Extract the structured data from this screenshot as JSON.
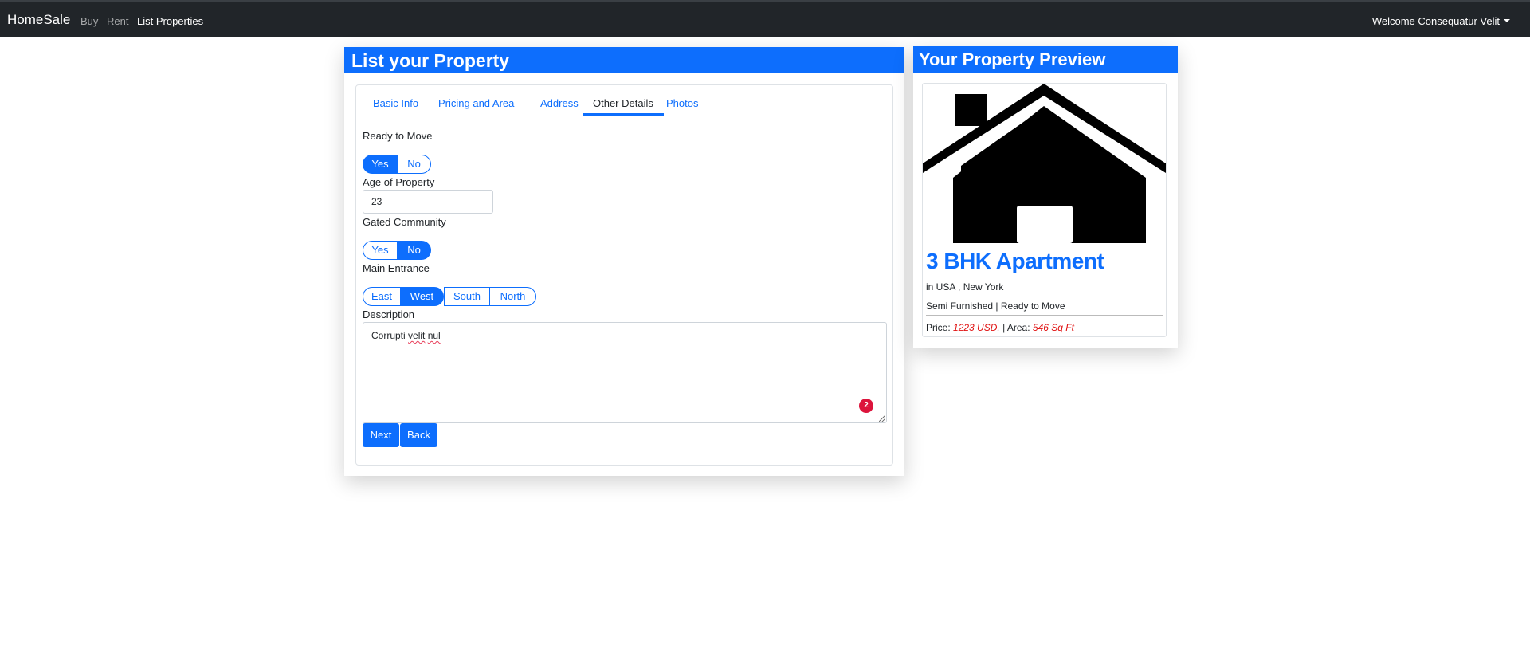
{
  "navbar": {
    "brand": "HomeSale",
    "links": [
      "Buy",
      "Rent",
      "List Properties"
    ],
    "user_menu": "Welcome Consequatur Velit"
  },
  "form_panel": {
    "title": "List your Property",
    "tabs": [
      "Basic Info",
      "Pricing and Area",
      "Address",
      "Other Details",
      "Photos"
    ],
    "active_tab": "Other Details",
    "ready_to_move": {
      "label": "Ready to Move",
      "options": [
        "Yes",
        "No"
      ],
      "selected": "Yes"
    },
    "age_of_property": {
      "label": "Age of Property",
      "value": "23"
    },
    "gated_community": {
      "label": "Gated Community",
      "options": [
        "Yes",
        "No"
      ],
      "selected": "No"
    },
    "main_entrance": {
      "label": "Main Entrance",
      "options": [
        "East",
        "West",
        "South",
        "North"
      ],
      "selected": "West"
    },
    "description": {
      "label": "Description",
      "value_prefix": "Corrupti ",
      "value_misspelled_1": "velit",
      "value_space": " ",
      "value_misspelled_2": "nul",
      "badge_count": "2"
    },
    "buttons": {
      "next": "Next",
      "back": "Back"
    }
  },
  "preview_panel": {
    "title": "Your Property Preview",
    "property_title": "3 BHK Apartment",
    "location": "in USA , New York",
    "features": "Semi Furnished | Ready to Move",
    "price_label": "Price:",
    "price_value": "1223 USD.",
    "separator": "|",
    "area_label": "Area:",
    "area_value": "546 Sq Ft"
  },
  "colors": {
    "primary": "#0d6efd",
    "navbar": "#212529",
    "accent_red": "#e01010",
    "badge": "#dc143c"
  },
  "icons": {
    "house": "house-icon",
    "dropdown": "caret-down-icon"
  }
}
